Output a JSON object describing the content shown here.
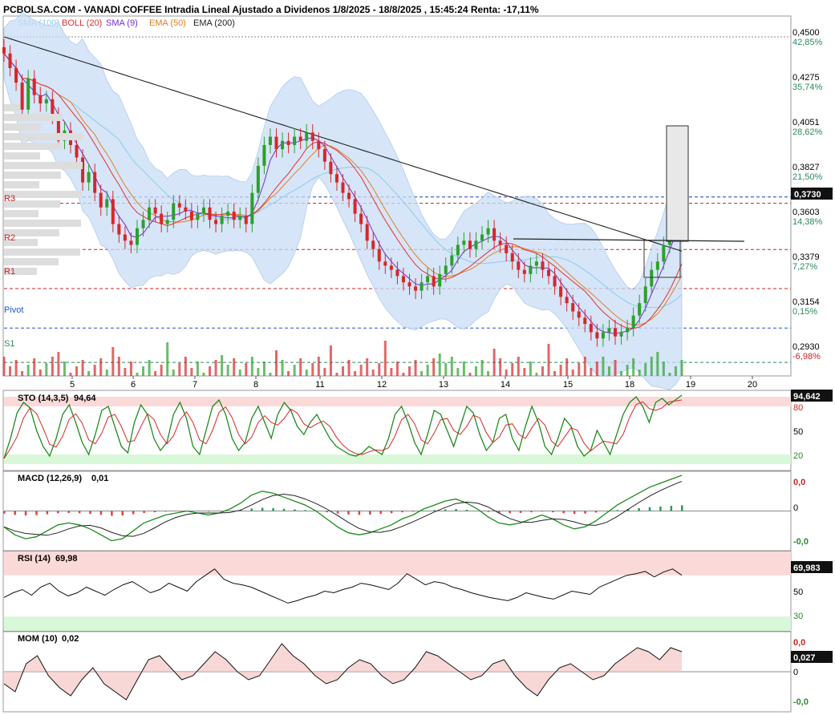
{
  "header": {
    "title": "PCBOLSA.COM - VANADI COFFEE Intradia Lineal Ajustado a Dividenos 1/8/2025 - 18/8/2025 , 15:45:24 Renta: -17,11%"
  },
  "legend": [
    {
      "label": "SMA (100)",
      "color": "#87ceeb"
    },
    {
      "label": "BOLL (20)",
      "color": "#e03030"
    },
    {
      "label": "SMA (9)",
      "color": "#7030d0"
    },
    {
      "label": "EMA (50)",
      "color": "#e08020"
    },
    {
      "label": "EMA (200)",
      "color": "#222222"
    }
  ],
  "colors": {
    "up": "#2ca02c",
    "down": "#d62728",
    "boll_fill": "#c9dcf5",
    "pivot": "#2255cc",
    "resistance": "#cc2222"
  },
  "chart_data": [
    {
      "type": "candlestick",
      "title": "VANADI COFFEE",
      "x_tick_labels": [
        "5",
        "6",
        "7",
        "8",
        "11",
        "12",
        "13",
        "14",
        "15",
        "18",
        "19",
        "20"
      ],
      "y_ticks": [
        {
          "price": "0,4500",
          "pct": "42,85%"
        },
        {
          "price": "0,4275",
          "pct": "35,74%"
        },
        {
          "price": "0,4051",
          "pct": "28,62%"
        },
        {
          "price": "0,3827",
          "pct": "21,50%"
        },
        {
          "price": "0,3603",
          "pct": "14,38%"
        },
        {
          "price": "0,3379",
          "pct": "7,27%"
        },
        {
          "price": "0,3154",
          "pct": "0,15%"
        },
        {
          "price": "0,2930",
          "pct": "-6,98%"
        }
      ],
      "ylim": [
        0.287,
        0.46
      ],
      "last_price": "0,3730",
      "levels": [
        {
          "name": "R3",
          "value": 0.37
        },
        {
          "name": "R2",
          "value": 0.3478
        },
        {
          "name": "R1",
          "value": 0.329
        },
        {
          "name": "Pivot",
          "value": 0.31
        },
        {
          "name": "S1",
          "value": 0.2935
        }
      ],
      "close_series": [
        0.442,
        0.435,
        0.428,
        0.415,
        0.43,
        0.422,
        0.418,
        0.42,
        0.412,
        0.4,
        0.405,
        0.398,
        0.392,
        0.38,
        0.385,
        0.375,
        0.368,
        0.372,
        0.36,
        0.355,
        0.352,
        0.35,
        0.358,
        0.362,
        0.368,
        0.365,
        0.36,
        0.362,
        0.37,
        0.368,
        0.366,
        0.362,
        0.365,
        0.368,
        0.362,
        0.36,
        0.364,
        0.366,
        0.362,
        0.364,
        0.36,
        0.375,
        0.388,
        0.398,
        0.402,
        0.396,
        0.4,
        0.398,
        0.402,
        0.4,
        0.404,
        0.4,
        0.396,
        0.39,
        0.384,
        0.38,
        0.375,
        0.372,
        0.365,
        0.36,
        0.352,
        0.348,
        0.342,
        0.34,
        0.338,
        0.335,
        0.332,
        0.33,
        0.328,
        0.332,
        0.335,
        0.33,
        0.336,
        0.34,
        0.345,
        0.35,
        0.352,
        0.348,
        0.352,
        0.355,
        0.358,
        0.352,
        0.35,
        0.346,
        0.342,
        0.338,
        0.336,
        0.34,
        0.342,
        0.338,
        0.335,
        0.33,
        0.325,
        0.322,
        0.318,
        0.315,
        0.312,
        0.308,
        0.305,
        0.308,
        0.31,
        0.306,
        0.308,
        0.31,
        0.316,
        0.322,
        0.33,
        0.338,
        0.342,
        0.35,
        0.36,
        0.368,
        0.373
      ]
    },
    {
      "type": "line",
      "name": "STO",
      "label": "STO (14,3,5)",
      "value_label": "94,64",
      "badge": "94,642",
      "ticks": [
        "80",
        "50",
        "20"
      ],
      "ylim": [
        0,
        100
      ],
      "values": [
        15,
        40,
        72,
        85,
        78,
        50,
        30,
        18,
        40,
        70,
        82,
        60,
        35,
        20,
        45,
        75,
        80,
        55,
        30,
        22,
        60,
        82,
        70,
        40,
        25,
        35,
        70,
        85,
        65,
        30,
        20,
        50,
        80,
        88,
        70,
        40,
        25,
        35,
        65,
        80,
        60,
        40,
        70,
        85,
        75,
        55,
        45,
        60,
        70,
        55,
        40,
        30,
        25,
        20,
        18,
        22,
        30,
        25,
        20,
        40,
        70,
        80,
        60,
        35,
        20,
        45,
        75,
        70,
        50,
        30,
        55,
        80,
        72,
        45,
        25,
        35,
        65,
        70,
        40,
        25,
        55,
        80,
        60,
        30,
        20,
        40,
        65,
        55,
        30,
        18,
        25,
        50,
        35,
        20,
        45,
        70,
        85,
        92,
        80,
        60,
        85,
        90,
        82,
        88,
        94
      ]
    },
    {
      "type": "line",
      "name": "MACD",
      "label": "MACD (12,26,9)",
      "value_label": "0,01",
      "ticks": [
        "0,0",
        "0",
        "-0,0"
      ],
      "badge_top": "0,0",
      "ylim": [
        -1,
        1
      ],
      "values": [
        -0.4,
        -0.6,
        -0.7,
        -0.65,
        -0.5,
        -0.35,
        -0.3,
        -0.35,
        -0.45,
        -0.6,
        -0.75,
        -0.7,
        -0.5,
        -0.3,
        -0.2,
        -0.1,
        -0.05,
        0.0,
        -0.05,
        -0.1,
        -0.05,
        0.05,
        0.2,
        0.4,
        0.5,
        0.45,
        0.35,
        0.25,
        0.15,
        0.0,
        -0.2,
        -0.4,
        -0.55,
        -0.6,
        -0.55,
        -0.45,
        -0.35,
        -0.2,
        -0.1,
        0.05,
        0.15,
        0.25,
        0.3,
        0.2,
        0.05,
        -0.15,
        -0.3,
        -0.35,
        -0.3,
        -0.2,
        -0.1,
        -0.2,
        -0.35,
        -0.45,
        -0.4,
        -0.25,
        -0.05,
        0.15,
        0.3,
        0.45,
        0.6,
        0.7,
        0.8,
        0.9
      ]
    },
    {
      "type": "line",
      "name": "RSI",
      "label": "RSI (14)",
      "value_label": "69,98",
      "badge": "69,983",
      "ticks": [
        "50",
        "30"
      ],
      "ylim": [
        0,
        100
      ],
      "values": [
        42,
        48,
        52,
        45,
        55,
        60,
        50,
        44,
        48,
        55,
        50,
        45,
        52,
        58,
        62,
        55,
        48,
        52,
        60,
        55,
        50,
        62,
        70,
        78,
        65,
        60,
        58,
        55,
        50,
        45,
        40,
        35,
        38,
        42,
        45,
        50,
        48,
        52,
        55,
        60,
        58,
        55,
        52,
        60,
        72,
        65,
        58,
        62,
        60,
        55,
        52,
        48,
        45,
        42,
        40,
        38,
        42,
        48,
        45,
        42,
        40,
        45,
        50,
        48,
        46,
        55,
        60,
        65,
        70,
        72,
        75,
        68,
        74,
        78,
        70
      ]
    },
    {
      "type": "line",
      "name": "MOM",
      "label": "MOM (10)",
      "value_label": "0,02",
      "badge": "0,027",
      "badge_top": "0,0",
      "ticks": [
        "0",
        "-0,0"
      ],
      "ylim": [
        -1,
        1
      ],
      "values": [
        -0.3,
        -0.5,
        0.2,
        0.4,
        -0.1,
        -0.4,
        -0.6,
        -0.2,
        0.1,
        -0.3,
        -0.5,
        -0.7,
        -0.2,
        0.3,
        0.4,
        0.1,
        -0.2,
        -0.1,
        0.2,
        0.5,
        0.3,
        0.0,
        -0.2,
        -0.1,
        0.3,
        0.7,
        0.4,
        0.2,
        -0.1,
        -0.3,
        -0.2,
        0.1,
        0.3,
        0.2,
        -0.1,
        -0.3,
        -0.2,
        0.1,
        0.5,
        0.4,
        0.2,
        0.0,
        -0.2,
        -0.1,
        0.2,
        0.3,
        -0.1,
        -0.4,
        -0.6,
        -0.2,
        0.1,
        0.2,
        0.0,
        -0.2,
        -0.1,
        0.2,
        0.4,
        0.6,
        0.5,
        0.3,
        0.6,
        0.5
      ]
    }
  ]
}
